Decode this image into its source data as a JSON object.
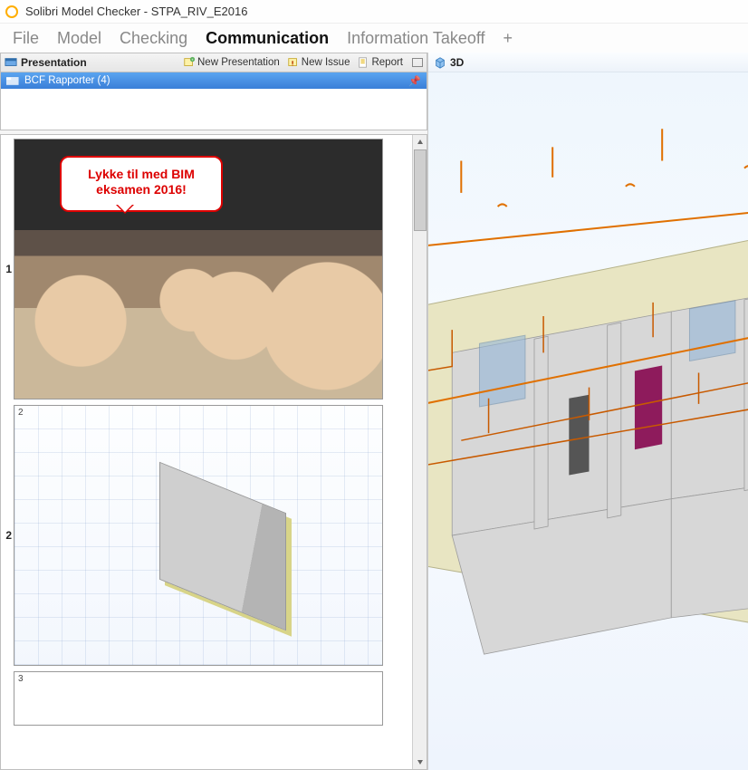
{
  "app": {
    "title": "Solibri Model Checker - STPA_RIV_E2016"
  },
  "menu": {
    "items": [
      {
        "label": "File",
        "active": false
      },
      {
        "label": "Model",
        "active": false
      },
      {
        "label": "Checking",
        "active": false
      },
      {
        "label": "Communication",
        "active": true
      },
      {
        "label": "Information Takeoff",
        "active": false
      }
    ],
    "plus": "+"
  },
  "presentation_panel": {
    "title": "Presentation",
    "tools": {
      "new_presentation": "New Presentation",
      "new_issue": "New Issue",
      "report": "Report"
    },
    "list": {
      "items": [
        {
          "label": "BCF Rapporter (4)"
        }
      ]
    }
  },
  "slides_panel": {
    "slides": [
      {
        "number": "1",
        "type": "photo",
        "speech_line1": "Lykke til med BIM",
        "speech_line2": "eksamen 2016!"
      },
      {
        "number": "2",
        "type": "wall",
        "corner": "2"
      },
      {
        "number": "3",
        "type": "empty",
        "corner": "3"
      }
    ]
  },
  "view3d": {
    "title": "3D"
  }
}
